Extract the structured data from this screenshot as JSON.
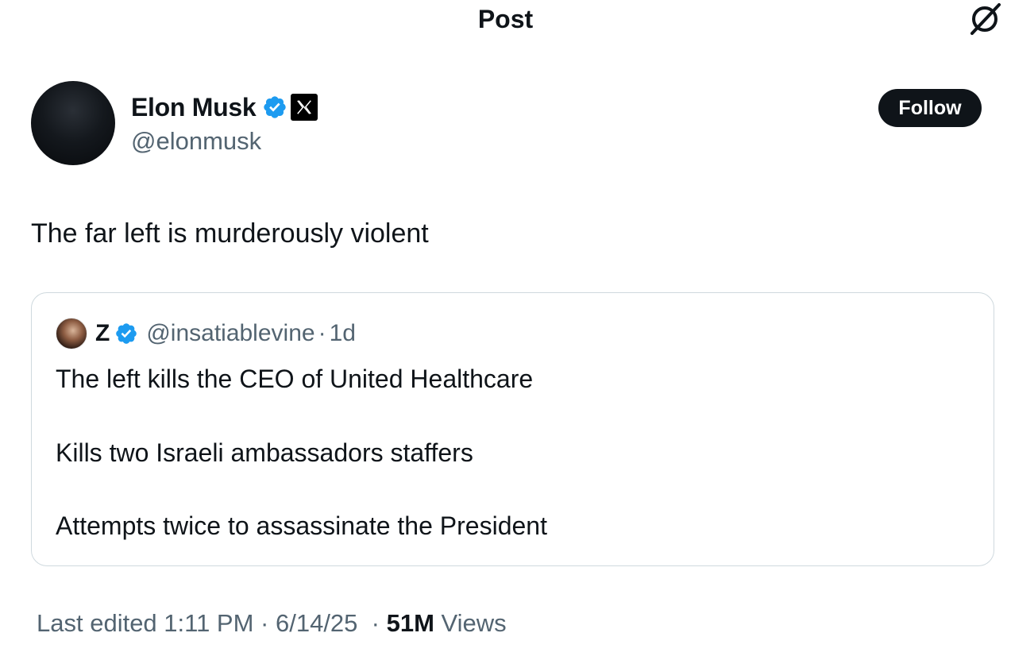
{
  "header": {
    "title": "Post",
    "grok_icon": "grok-icon"
  },
  "author": {
    "display_name": "Elon Musk",
    "handle": "@elonmusk",
    "verified_icon": "verified-badge-icon",
    "affiliation_icon": "x-logo-icon"
  },
  "follow_button": {
    "label": "Follow"
  },
  "post": {
    "text": "The far left is murderously violent"
  },
  "quote": {
    "display_name": "Z",
    "handle": "@insatiablevine",
    "separator": "·",
    "time": "1d",
    "lines": [
      "The left kills the CEO of United Healthcare",
      "Kills two Israeli ambassadors staffers",
      "Attempts twice to assassinate the President"
    ]
  },
  "meta": {
    "edited": "Last edited 1:11 PM · 6/14/25",
    "separator": "·",
    "views_count": "51M",
    "views_label": "Views"
  },
  "colors": {
    "text_primary": "#0f1419",
    "text_secondary": "#536471",
    "verified_blue": "#1d9bf0",
    "border": "#cfd9de",
    "button_bg": "#0f1419"
  }
}
